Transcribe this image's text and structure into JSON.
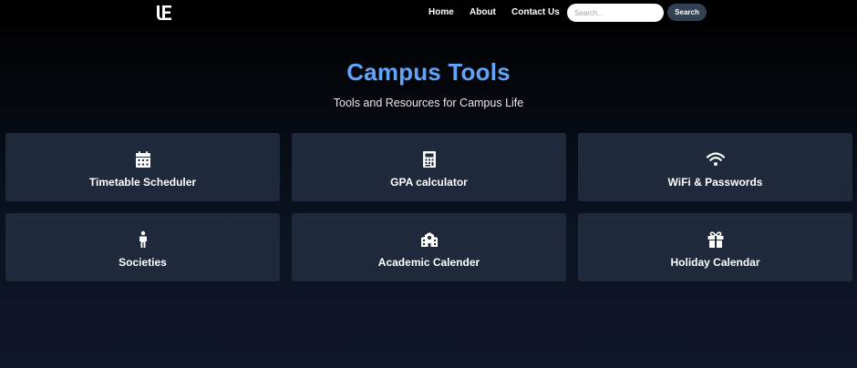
{
  "brand": {
    "logo_icon": "ue-logo-icon"
  },
  "nav": {
    "links": [
      {
        "label": "Home"
      },
      {
        "label": "About"
      },
      {
        "label": "Contact Us"
      }
    ],
    "search": {
      "placeholder": "Search...",
      "button_label": "Search"
    }
  },
  "hero": {
    "title": "Campus Tools",
    "subtitle": "Tools and Resources for Campus Life"
  },
  "tools": [
    {
      "label": "Timetable Scheduler",
      "icon": "calendar-icon"
    },
    {
      "label": "GPA calculator",
      "icon": "calculator-icon"
    },
    {
      "label": "WiFi & Passwords",
      "icon": "wifi-icon"
    },
    {
      "label": "Societies",
      "icon": "person-icon"
    },
    {
      "label": "Academic Calender",
      "icon": "school-icon"
    },
    {
      "label": "Holiday Calendar",
      "icon": "gift-icon"
    }
  ],
  "colors": {
    "accent": "#60a5fa",
    "card_bg": "#1e293b",
    "search_button_bg": "#334155"
  }
}
